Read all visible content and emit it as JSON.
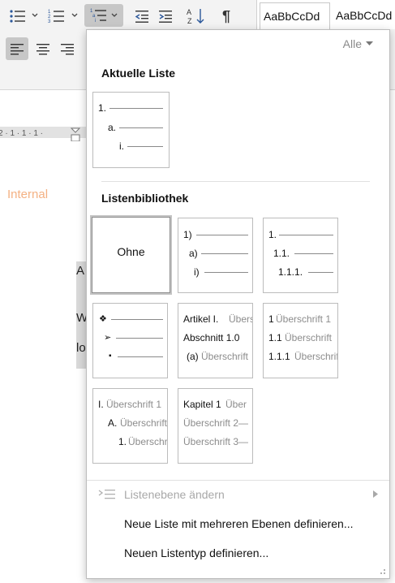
{
  "ribbon": {
    "icons": [
      "bullets-icon",
      "numbering-icon",
      "multilevel-list-icon",
      "decrease-indent-icon",
      "increase-indent-icon",
      "sort-icon",
      "show-formatting-icon",
      "align-left-icon",
      "align-center-icon",
      "align-right-icon"
    ],
    "styles": [
      "AaBbCcDd",
      "AaBbCcDd"
    ]
  },
  "document": {
    "label": "Internal",
    "strip_letters": [
      "A",
      "W",
      "lo"
    ]
  },
  "menu": {
    "filter_label": "Alle",
    "current_section_title": "Aktuelle Liste",
    "library_section_title": "Listenbibliothek",
    "current_list": {
      "levels": [
        "1.",
        "a.",
        "i."
      ]
    },
    "library": [
      {
        "kind": "none",
        "label": "Ohne"
      },
      {
        "kind": "simple",
        "levels": [
          "1)",
          "a)",
          "i)"
        ]
      },
      {
        "kind": "simple",
        "levels": [
          "1.",
          "1.1.",
          "1.1.1."
        ]
      },
      {
        "kind": "bullets",
        "levels": [
          "❖",
          "➢",
          "▪"
        ]
      },
      {
        "kind": "headed",
        "rows": [
          {
            "num": "Artikel I.",
            "text": "Übers"
          },
          {
            "num": "Abschnitt 1.0",
            "text": ""
          },
          {
            "num": "(a)",
            "text": "Überschrift"
          }
        ]
      },
      {
        "kind": "headed",
        "rows": [
          {
            "num": "1",
            "text": "Überschrift 1"
          },
          {
            "num": "1.1",
            "text": "Überschrift"
          },
          {
            "num": "1.1.1",
            "text": "Überschrift"
          }
        ]
      },
      {
        "kind": "headed",
        "rows": [
          {
            "num": "I.",
            "text": "Überschrift 1"
          },
          {
            "num": "A.",
            "text": "Überschrift"
          },
          {
            "num": "1.",
            "text": "Überschrift"
          }
        ]
      },
      {
        "kind": "headed",
        "rows": [
          {
            "num": "Kapitel 1",
            "text": "Über"
          },
          {
            "num": "",
            "text": "Überschrift 2—"
          },
          {
            "num": "",
            "text": "Überschrift 3—"
          }
        ]
      }
    ],
    "items": [
      {
        "label": "Listenebene ändern",
        "enabled": false,
        "has_submenu": true
      },
      {
        "label": "Neue Liste mit mehreren Ebenen definieren...",
        "enabled": true
      },
      {
        "label": "Neuen Listentyp definieren...",
        "enabled": true
      }
    ]
  },
  "colors": {
    "accent_internal": "#f4b183",
    "selected_button": "#c7c7c7"
  }
}
